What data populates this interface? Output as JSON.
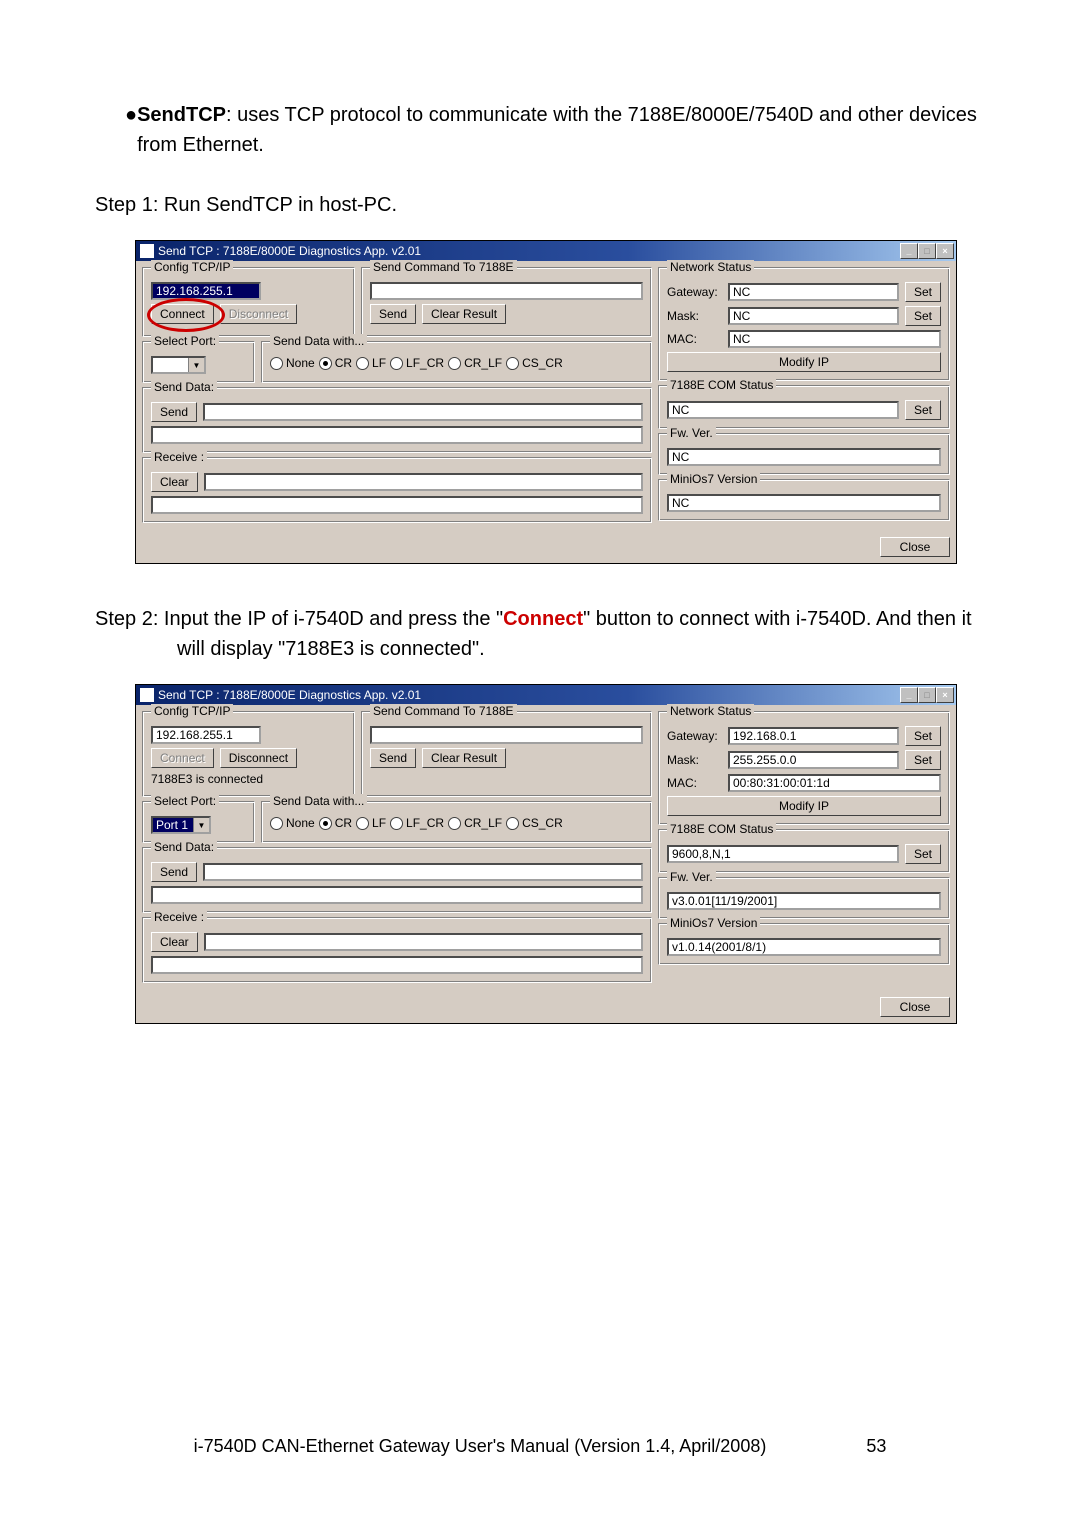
{
  "intro": {
    "bullet": "●",
    "bold": "SendTCP",
    "rest": ": uses TCP protocol to communicate with the 7188E/8000E/7540D and other devices from Ethernet."
  },
  "step1": "Step 1: Run SendTCP in host-PC.",
  "step2_a": "Step 2:   Input the IP of i-7540D and press the \"",
  "step2_connect": "Connect",
  "step2_b": "\" button to connect with i-7540D. And then it will display \"7188E3 is connected\".",
  "window": {
    "title": "Send TCP : 7188E/8000E Diagnostics App. v2.01",
    "groups": {
      "config": "Config TCP/IP",
      "sendcmd": "Send Command To 7188E",
      "selectport": "Select Port:",
      "senddatawith": "Send Data with...",
      "senddata": "Send Data:",
      "receive": "Receive :",
      "network": "Network Status",
      "comstatus": "7188E COM Status",
      "fwver": "Fw. Ver.",
      "minios": "MiniOs7 Version"
    },
    "buttons": {
      "connect": "Connect",
      "disconnect": "Disconnect",
      "send": "Send",
      "clear_result": "Clear Result",
      "clear": "Clear",
      "set": "Set",
      "modifyip": "Modify IP",
      "close": "Close"
    },
    "labels": {
      "gateway": "Gateway:",
      "mask": "Mask:",
      "mac": "MAC:"
    },
    "radios": [
      "None",
      "CR",
      "LF",
      "LF_CR",
      "CR_LF",
      "CS_CR"
    ]
  },
  "window1": {
    "ip": "192.168.255.1",
    "status": "",
    "port": "",
    "gateway": "NC",
    "mask": "NC",
    "mac": "NC",
    "com": "NC",
    "fw": "NC",
    "minios": "NC",
    "radio_selected": 1
  },
  "window2": {
    "ip": "192.168.255.1",
    "status": "7188E3 is connected",
    "port": "Port 1",
    "gateway": "192.168.0.1",
    "mask": "255.255.0.0",
    "mac": "00:80:31:00:01:1d",
    "com": "9600,8,N,1",
    "fw": "v3.0.01[11/19/2001]",
    "minios": "v1.0.14(2001/8/1)",
    "radio_selected": 1
  },
  "footer": {
    "text": "i-7540D CAN-Ethernet Gateway User's Manual (Version 1.4, April/2008)",
    "page": "53"
  }
}
